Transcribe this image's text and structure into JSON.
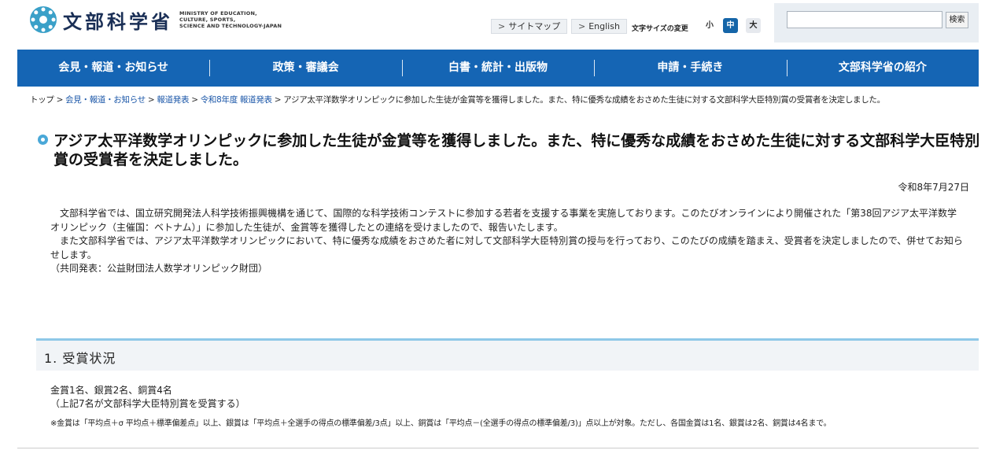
{
  "header": {
    "logo_text": "文部科学省",
    "logo_en": "MINISTRY OF EDUCATION,\nCULTURE, SPORTS,\nSCIENCE AND TECHNOLOGY-JAPAN",
    "sitemap_label": "サイトマップ",
    "english_label": "English",
    "fontsize_label": "文字サイズの変更",
    "fontsize_small": "小",
    "fontsize_mid": "中",
    "fontsize_large": "大",
    "search_placeholder": "",
    "search_button": "検索"
  },
  "nav": {
    "items": [
      "会見・報道・お知らせ",
      "政策・審議会",
      "白書・統計・出版物",
      "申請・手続き",
      "文部科学省の紹介"
    ]
  },
  "breadcrumb": {
    "items": [
      "トップ",
      "会見・報道・お知らせ",
      "報道発表",
      "令和8年度 報道発表"
    ],
    "current": "アジア太平洋数学オリンピックに参加した生徒が金賞等を獲得しました。また、特に優秀な成績をおさめた生徒に対する文部科学大臣特別賞の受賞者を決定しました。"
  },
  "article": {
    "title": "アジア太平洋数学オリンピックに参加した生徒が金賞等を獲得しました。また、特に優秀な成績をおさめた生徒に対する文部科学大臣特別賞の受賞者を決定しました。",
    "date": "令和8年7月27日",
    "paragraph1": "　文部科学省では、国立研究開発法人科学技術振興機構を通じて、国際的な科学技術コンテストに参加する若者を支援する事業を実施しております。このたびオンラインにより開催された「第38回アジア太平洋数学オリンピック（主催国：ベトナム）」に参加した生徒が、金賞等を獲得したとの連絡を受けましたので、報告いたします。",
    "paragraph2": "　また文部科学省では、アジア太平洋数学オリンピックにおいて、特に優秀な成績をおさめた者に対して文部科学大臣特別賞の授与を行っており、このたびの成績を踏まえ、受賞者を決定しましたので、併せてお知らせします。",
    "paragraph3": "（共同発表：公益財団法人数学オリンピック財団）"
  },
  "section": {
    "heading": "1. 受賞状況",
    "awards_line1": "金賞1名、銀賞2名、銅賞4名",
    "awards_line2": "（上記7名が文部科学大臣特別賞を受賞する）",
    "note": "※金賞は「平均点＋σ 平均点＋標準偏差点」以上、銀賞は「平均点＋全選手の得点の標準偏差/3点」以上、銅賞は「平均点－(全選手の得点の標準偏差/3)」点以上が対象。ただし、各国金賞は1名、銀賞は2名、銅賞は4名まで。"
  },
  "colors": {
    "nav_bg": "#1565b4",
    "accent": "#4aa8d8",
    "link": "#1a56a8"
  }
}
